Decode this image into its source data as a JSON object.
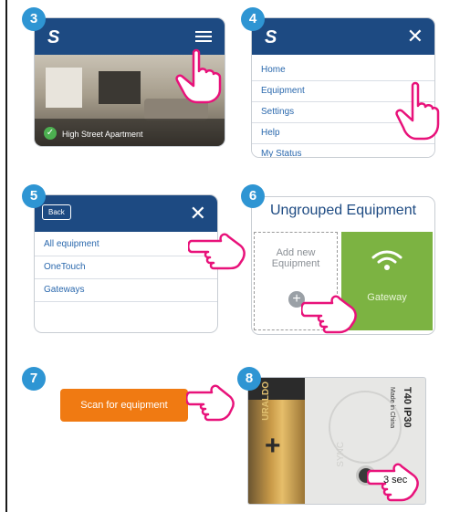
{
  "steps": [
    "3",
    "4",
    "5",
    "6",
    "7",
    "8"
  ],
  "step3": {
    "location": "High Street Apartment"
  },
  "step4": {
    "menu": [
      "Home",
      "Equipment",
      "Settings",
      "Help",
      "My Status"
    ]
  },
  "step5": {
    "back": "Back",
    "items": [
      "All equipment",
      "OneTouch",
      "Gateways"
    ]
  },
  "step6": {
    "title": "Ungrouped Equipment",
    "add_line1": "Add new",
    "add_line2": "Equipment",
    "gateway": "Gateway"
  },
  "step7": {
    "scan": "Scan for equipment"
  },
  "step8": {
    "duration": "3 sec",
    "model": "T40 IP30",
    "origin": "Made in China",
    "sync": "SYNC",
    "brand": "URALDO"
  },
  "colors": {
    "header": "#1d4a82",
    "badge": "#2e95d3",
    "accent": "#e8127a",
    "gateway": "#7cb342",
    "scan": "#f07a12"
  }
}
